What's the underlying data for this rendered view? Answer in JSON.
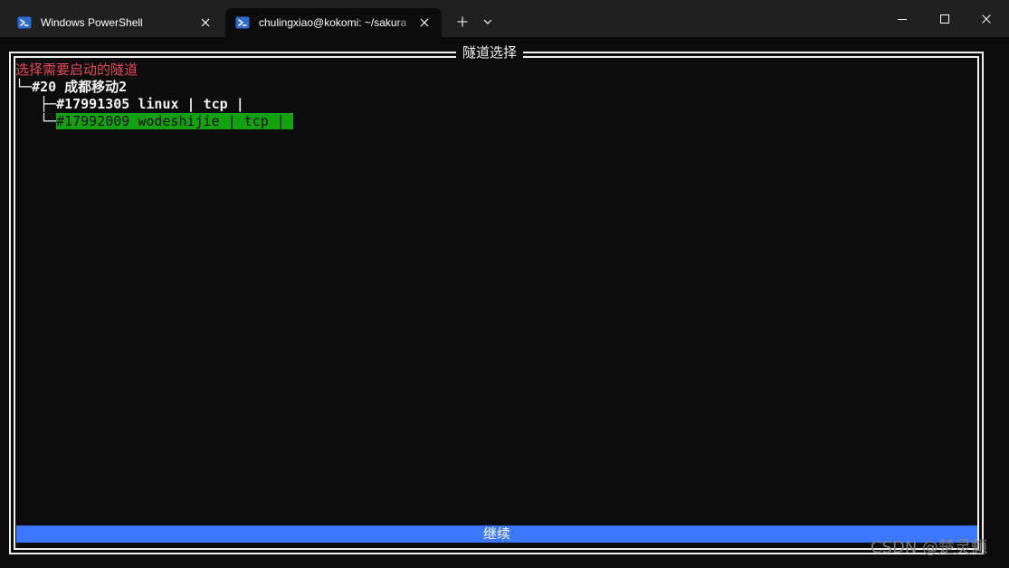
{
  "tabs": [
    {
      "title": "Windows PowerShell",
      "active": false
    },
    {
      "title": "chulingxiao@kokomi: ~/sakura",
      "active": true
    }
  ],
  "titlebar": {
    "new_tab_glyph": "+",
    "icons": {
      "tab_icon": "powershell-icon",
      "close": "close-icon",
      "dropdown": "chevron-down-icon",
      "minimize": "minimize-icon",
      "maximize": "maximize-icon",
      "window_close": "window-close-icon"
    }
  },
  "terminal": {
    "frame_title": "隧道选择",
    "prompt": "选择需要启动的隧道",
    "tree": {
      "group": {
        "branch": "└─",
        "label": "#20 成都移动2"
      },
      "items": [
        {
          "branch": "├─",
          "label": "#17991305 linux | tcp |",
          "selected": false
        },
        {
          "branch": "└─",
          "label": "#17992009 wodeshijie | tcp |",
          "selected": true
        }
      ]
    },
    "continue_button": "继续"
  },
  "watermark": "CSDN @楚灵魈",
  "colors": {
    "background": "#0c0c0c",
    "titlebar": "#202020",
    "prompt": "#e74856",
    "selection": "#13a10e",
    "button": "#3b78ff",
    "text": "#f2f2f2"
  }
}
